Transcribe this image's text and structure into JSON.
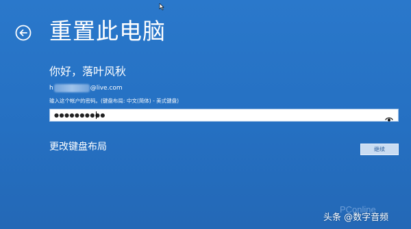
{
  "window": {
    "title": "重置此电脑"
  },
  "account": {
    "greeting": "你好，落叶风秋",
    "email_prefix": "h",
    "email_suffix": "@live.com"
  },
  "password": {
    "instruction": "输入这个帐户的密码。(键盘布局: 中文(简体) - 美式键盘)",
    "masked_value": "●●●●●●●●●●"
  },
  "actions": {
    "change_keyboard_layout": "更改键盘布局",
    "continue_label": "继续"
  },
  "watermarks": {
    "pconline": "PConline",
    "toutiao": "头条 @数字音频"
  },
  "icons": {
    "back": "back-arrow-circle-icon",
    "reveal": "eye-reveal-icon",
    "cursor": "mouse-pointer-icon"
  },
  "colors": {
    "background": "#2672c5",
    "text": "#ffffff",
    "button_fill": "#c9dcf2"
  }
}
